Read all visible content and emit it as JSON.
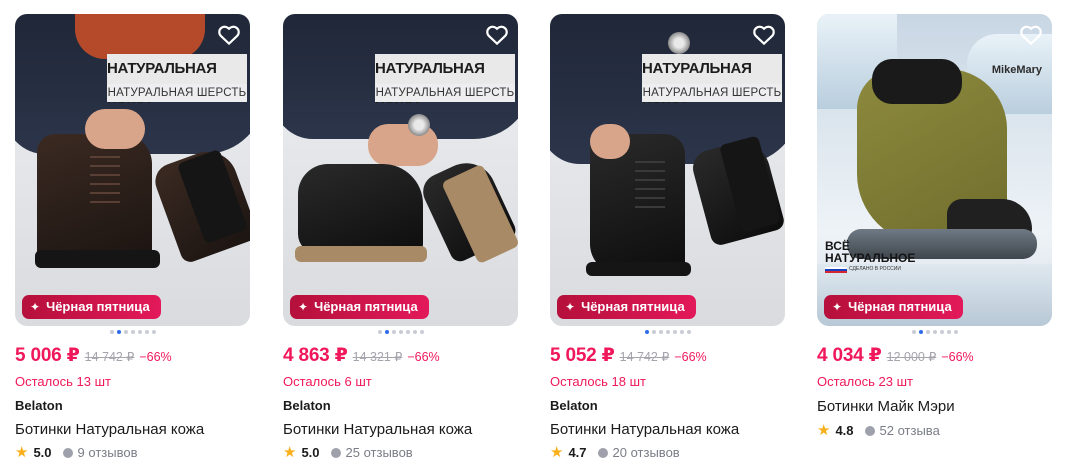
{
  "products": [
    {
      "banner_title": "НАТУРАЛЬНАЯ КОЖА",
      "banner_subtitle": "НАТУРАЛЬНАЯ ШЕРСТЬ",
      "badge": "Чёрная пятница",
      "price": "5 006 ₽",
      "old_price": "14 742 ₽",
      "discount": "−66%",
      "stock": "Осталось 13 шт",
      "brand": "Belaton",
      "title": "Ботинки Натуральная кожа",
      "rating": "5.0",
      "reviews": "9 отзывов",
      "active_photo": 1
    },
    {
      "banner_title": "НАТУРАЛЬНАЯ КОЖА",
      "banner_subtitle": "НАТУРАЛЬНАЯ ШЕРСТЬ",
      "badge": "Чёрная пятница",
      "price": "4 863 ₽",
      "old_price": "14 321 ₽",
      "discount": "−66%",
      "stock": "Осталось 6 шт",
      "brand": "Belaton",
      "title": "Ботинки Натуральная кожа",
      "rating": "5.0",
      "reviews": "25 отзывов",
      "active_photo": 1
    },
    {
      "banner_title": "НАТУРАЛЬНАЯ КОЖА",
      "banner_subtitle": "НАТУРАЛЬНАЯ ШЕРСТЬ",
      "badge": "Чёрная пятница",
      "price": "5 052 ₽",
      "old_price": "14 742 ₽",
      "discount": "−66%",
      "stock": "Осталось 18 шт",
      "brand": "Belaton",
      "title": "Ботинки Натуральная кожа",
      "rating": "4.7",
      "reviews": "20 отзывов",
      "active_photo": 0
    },
    {
      "brand_mark": "MikeMary",
      "eco_label": "ВСЁ НАТУРАЛЬНОЕ",
      "eco_sub": "СДЕЛАНО В РОССИИ",
      "badge": "Чёрная пятница",
      "price": "4 034 ₽",
      "old_price": "12 000 ₽",
      "discount": "−66%",
      "stock": "Осталось 23 шт",
      "title": "Ботинки Майк Мэри",
      "rating": "4.8",
      "reviews": "52 отзыва",
      "active_photo": 1
    }
  ],
  "icons": {
    "favorite": "heart-icon",
    "badge": "sparkle-icon",
    "rating": "star-icon",
    "reviews": "comment-bubble-icon"
  },
  "colors": {
    "price": "#f0185a",
    "badge": "#d0124a",
    "star": "#f9b01b",
    "active_dot": "#2d6ee8"
  }
}
